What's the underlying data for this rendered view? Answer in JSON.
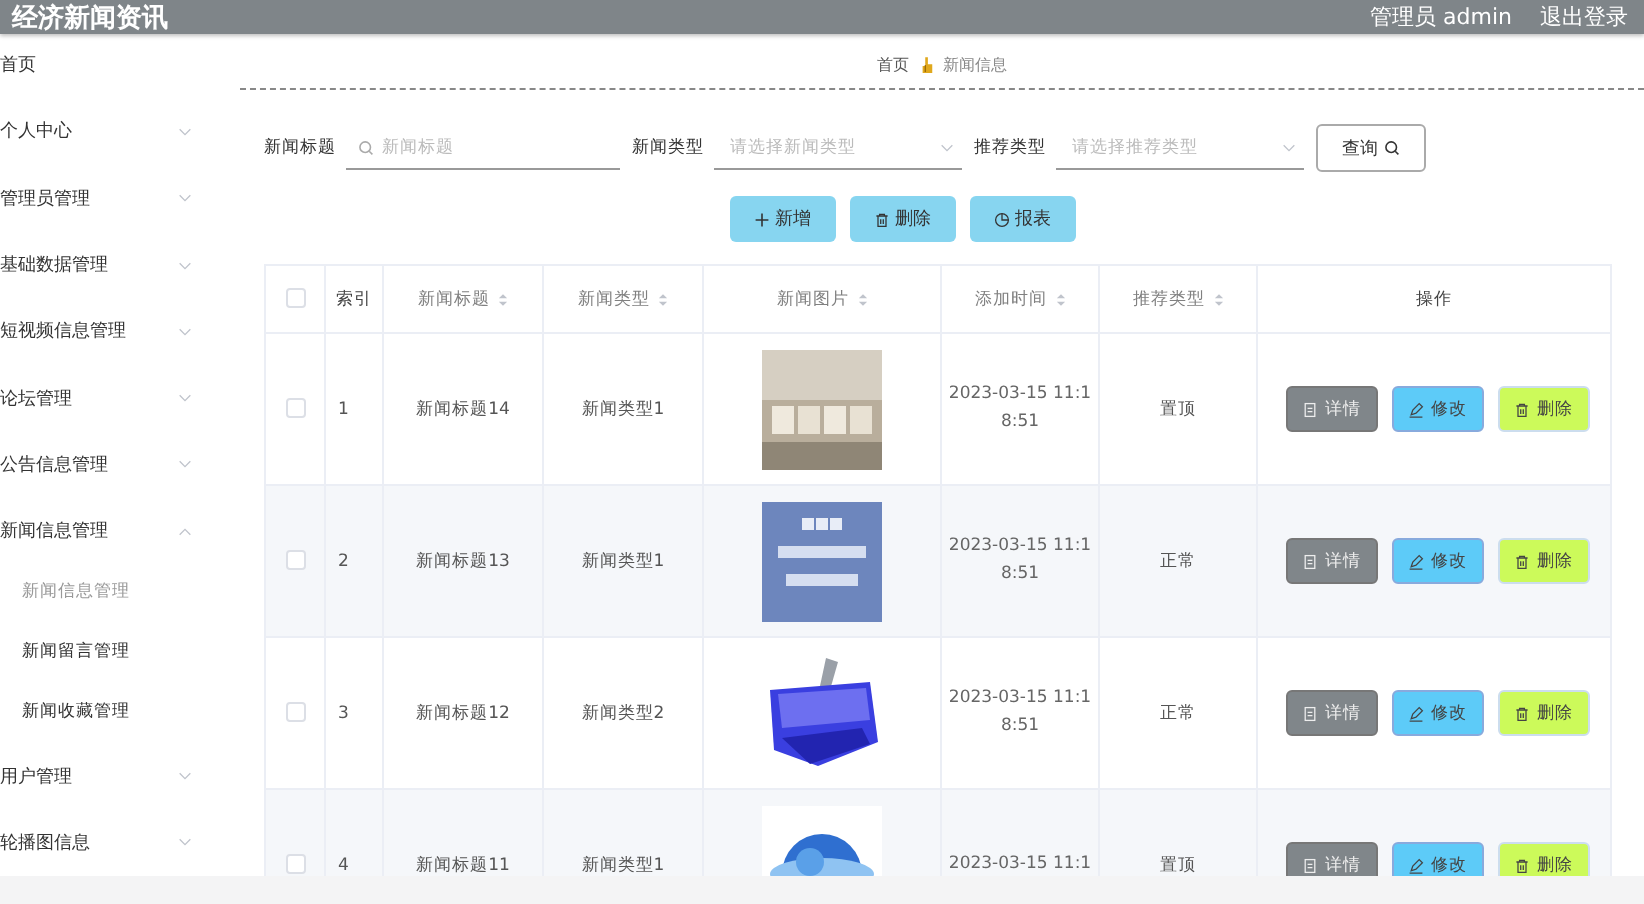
{
  "header": {
    "title": "经济新闻资讯",
    "user": "管理员 admin",
    "logout": "退出登录"
  },
  "sidebar": {
    "items": [
      {
        "label": "首页",
        "selected": false
      },
      {
        "label": "个人中心",
        "selected": false,
        "expanded": false
      },
      {
        "label": "管理员管理",
        "selected": false,
        "expanded": false
      },
      {
        "label": "基础数据管理",
        "selected": false,
        "expanded": false
      },
      {
        "label": "短视频信息管理",
        "selected": false,
        "expanded": false
      },
      {
        "label": "论坛管理",
        "selected": false,
        "expanded": false
      },
      {
        "label": "公告信息管理",
        "selected": false,
        "expanded": false
      },
      {
        "label": "新闻信息管理",
        "selected": false,
        "expanded": true,
        "children": [
          {
            "label": "新闻信息管理",
            "selected": true
          },
          {
            "label": "新闻留言管理",
            "selected": false
          },
          {
            "label": "新闻收藏管理",
            "selected": false
          }
        ]
      },
      {
        "label": "用户管理",
        "selected": false,
        "expanded": false
      },
      {
        "label": "轮播图信息",
        "selected": false,
        "expanded": false
      }
    ]
  },
  "breadcrumb": [
    "首页",
    "新闻信息"
  ],
  "search": {
    "fields": [
      {
        "kind": "input",
        "label": "新闻标题",
        "placeholder": "新闻标题"
      },
      {
        "kind": "select",
        "label": "新闻类型",
        "placeholder": "请选择新闻类型"
      },
      {
        "kind": "select",
        "label": "推荐类型",
        "placeholder": "请选择推荐类型"
      }
    ],
    "button": "查询"
  },
  "actions": [
    {
      "kind": "add",
      "label": "新增"
    },
    {
      "kind": "delete",
      "label": "删除"
    },
    {
      "kind": "report",
      "label": "报表"
    }
  ],
  "table": {
    "select_all": {
      "checked": false
    },
    "columns": [
      {
        "label": "索引",
        "sortable": false
      },
      {
        "label": "新闻标题",
        "sortable": true
      },
      {
        "label": "新闻类型",
        "sortable": true
      },
      {
        "label": "新闻图片",
        "sortable": true
      },
      {
        "label": "添加时间",
        "sortable": true
      },
      {
        "label": "推荐类型",
        "sortable": true
      },
      {
        "label": "操作",
        "sortable": false
      }
    ],
    "rows": [
      {
        "checked": false,
        "index": "1",
        "title": "新闻标题14",
        "type": "新闻类型1",
        "time": "2023-03-15 11:18:51",
        "recommend": "置顶",
        "buttons": [
          {
            "kind": "detail",
            "label": "详情"
          },
          {
            "kind": "edit",
            "label": "修改"
          },
          {
            "kind": "delete",
            "label": "删除"
          }
        ]
      },
      {
        "checked": false,
        "index": "2",
        "title": "新闻标题13",
        "type": "新闻类型1",
        "time": "2023-03-15 11:18:51",
        "recommend": "正常",
        "buttons": [
          {
            "kind": "detail",
            "label": "详情"
          },
          {
            "kind": "edit",
            "label": "修改"
          },
          {
            "kind": "delete",
            "label": "删除"
          }
        ]
      },
      {
        "checked": false,
        "index": "3",
        "title": "新闻标题12",
        "type": "新闻类型2",
        "time": "2023-03-15 11:18:51",
        "recommend": "正常",
        "buttons": [
          {
            "kind": "detail",
            "label": "详情"
          },
          {
            "kind": "edit",
            "label": "修改"
          },
          {
            "kind": "delete",
            "label": "删除"
          }
        ]
      },
      {
        "checked": false,
        "index": "4",
        "title": "新闻标题11",
        "type": "新闻类型1",
        "time": "2023-03-15 11:1",
        "recommend": "置顶",
        "buttons": [
          {
            "kind": "detail",
            "label": "详情"
          },
          {
            "kind": "edit",
            "label": "修改"
          },
          {
            "kind": "delete",
            "label": "删除"
          }
        ]
      }
    ]
  }
}
